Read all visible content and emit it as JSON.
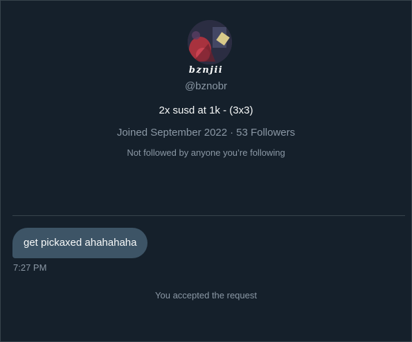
{
  "profile": {
    "display_name": "bznjii",
    "handle": "@bznobr",
    "bio": "2x susd at 1k - (3x3)",
    "joined": "Joined September 2022",
    "separator": "·",
    "followers": "53 Followers",
    "not_followed": "Not followed by anyone you’re following",
    "avatar_icon": "profile-avatar-image"
  },
  "messages": [
    {
      "text": "get pickaxed ahahahaha",
      "time": "7:27 PM"
    }
  ],
  "system_note": "You accepted the request",
  "colors": {
    "background": "#15202b",
    "bubble": "#3d5466",
    "secondary_text": "#8b98a5",
    "primary_text": "#f7f9f9",
    "divider": "#38444d"
  }
}
